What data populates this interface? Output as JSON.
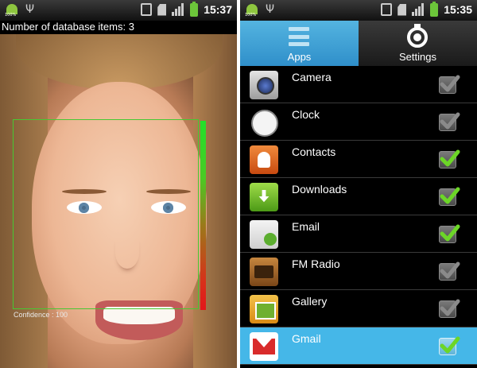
{
  "left_phone": {
    "status_bar": {
      "time": "15:37",
      "battery_text": "100%",
      "icons": [
        "android-battery-icon",
        "usb-icon",
        "vibrate-icon",
        "sd-card-icon",
        "signal-icon",
        "battery-icon"
      ]
    },
    "header": {
      "db_count_text": "Number of database items: 3"
    },
    "camera": {
      "confidence_text": "Confidence : 100",
      "confidence_value": 100,
      "box_color": "#47c832"
    }
  },
  "right_phone": {
    "status_bar": {
      "time": "15:35",
      "battery_text": "100%",
      "icons": [
        "android-battery-icon",
        "usb-icon",
        "vibrate-icon",
        "sd-card-icon",
        "signal-icon",
        "battery-icon"
      ]
    },
    "tabs": [
      {
        "label": "Apps",
        "icon": "menu-icon",
        "active": true
      },
      {
        "label": "Settings",
        "icon": "settings-icon",
        "active": false
      }
    ],
    "apps": [
      {
        "name": "Camera",
        "icon": "camera-icon",
        "checked": false,
        "highlighted": false
      },
      {
        "name": "Clock",
        "icon": "clock-icon",
        "checked": false,
        "highlighted": false
      },
      {
        "name": "Contacts",
        "icon": "contacts-icon",
        "checked": true,
        "highlighted": false
      },
      {
        "name": "Downloads",
        "icon": "downloads-icon",
        "checked": true,
        "highlighted": false
      },
      {
        "name": "Email",
        "icon": "email-icon",
        "checked": true,
        "highlighted": false
      },
      {
        "name": "FM Radio",
        "icon": "fm-radio-icon",
        "checked": false,
        "highlighted": false
      },
      {
        "name": "Gallery",
        "icon": "gallery-icon",
        "checked": false,
        "highlighted": false
      },
      {
        "name": "Gmail",
        "icon": "gmail-icon",
        "checked": true,
        "highlighted": true
      }
    ],
    "colors": {
      "accent": "#45b7e8",
      "check_on": "#6cd627",
      "check_off": "#8a8a8a"
    }
  }
}
